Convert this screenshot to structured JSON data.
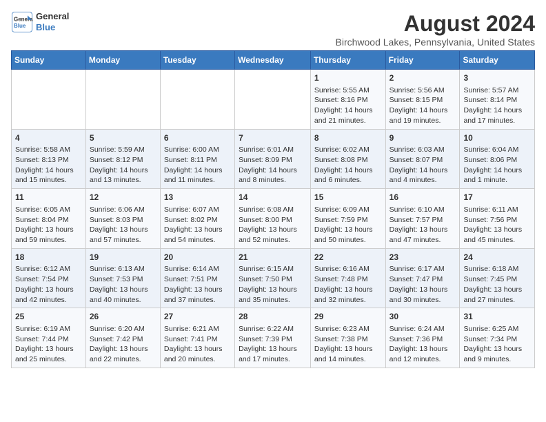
{
  "logo": {
    "line1": "General",
    "line2": "Blue"
  },
  "title": "August 2024",
  "subtitle": "Birchwood Lakes, Pennsylvania, United States",
  "days_of_week": [
    "Sunday",
    "Monday",
    "Tuesday",
    "Wednesday",
    "Thursday",
    "Friday",
    "Saturday"
  ],
  "weeks": [
    [
      {
        "day": "",
        "info": ""
      },
      {
        "day": "",
        "info": ""
      },
      {
        "day": "",
        "info": ""
      },
      {
        "day": "",
        "info": ""
      },
      {
        "day": "1",
        "info": "Sunrise: 5:55 AM\nSunset: 8:16 PM\nDaylight: 14 hours\nand 21 minutes."
      },
      {
        "day": "2",
        "info": "Sunrise: 5:56 AM\nSunset: 8:15 PM\nDaylight: 14 hours\nand 19 minutes."
      },
      {
        "day": "3",
        "info": "Sunrise: 5:57 AM\nSunset: 8:14 PM\nDaylight: 14 hours\nand 17 minutes."
      }
    ],
    [
      {
        "day": "4",
        "info": "Sunrise: 5:58 AM\nSunset: 8:13 PM\nDaylight: 14 hours\nand 15 minutes."
      },
      {
        "day": "5",
        "info": "Sunrise: 5:59 AM\nSunset: 8:12 PM\nDaylight: 14 hours\nand 13 minutes."
      },
      {
        "day": "6",
        "info": "Sunrise: 6:00 AM\nSunset: 8:11 PM\nDaylight: 14 hours\nand 11 minutes."
      },
      {
        "day": "7",
        "info": "Sunrise: 6:01 AM\nSunset: 8:09 PM\nDaylight: 14 hours\nand 8 minutes."
      },
      {
        "day": "8",
        "info": "Sunrise: 6:02 AM\nSunset: 8:08 PM\nDaylight: 14 hours\nand 6 minutes."
      },
      {
        "day": "9",
        "info": "Sunrise: 6:03 AM\nSunset: 8:07 PM\nDaylight: 14 hours\nand 4 minutes."
      },
      {
        "day": "10",
        "info": "Sunrise: 6:04 AM\nSunset: 8:06 PM\nDaylight: 14 hours\nand 1 minute."
      }
    ],
    [
      {
        "day": "11",
        "info": "Sunrise: 6:05 AM\nSunset: 8:04 PM\nDaylight: 13 hours\nand 59 minutes."
      },
      {
        "day": "12",
        "info": "Sunrise: 6:06 AM\nSunset: 8:03 PM\nDaylight: 13 hours\nand 57 minutes."
      },
      {
        "day": "13",
        "info": "Sunrise: 6:07 AM\nSunset: 8:02 PM\nDaylight: 13 hours\nand 54 minutes."
      },
      {
        "day": "14",
        "info": "Sunrise: 6:08 AM\nSunset: 8:00 PM\nDaylight: 13 hours\nand 52 minutes."
      },
      {
        "day": "15",
        "info": "Sunrise: 6:09 AM\nSunset: 7:59 PM\nDaylight: 13 hours\nand 50 minutes."
      },
      {
        "day": "16",
        "info": "Sunrise: 6:10 AM\nSunset: 7:57 PM\nDaylight: 13 hours\nand 47 minutes."
      },
      {
        "day": "17",
        "info": "Sunrise: 6:11 AM\nSunset: 7:56 PM\nDaylight: 13 hours\nand 45 minutes."
      }
    ],
    [
      {
        "day": "18",
        "info": "Sunrise: 6:12 AM\nSunset: 7:54 PM\nDaylight: 13 hours\nand 42 minutes."
      },
      {
        "day": "19",
        "info": "Sunrise: 6:13 AM\nSunset: 7:53 PM\nDaylight: 13 hours\nand 40 minutes."
      },
      {
        "day": "20",
        "info": "Sunrise: 6:14 AM\nSunset: 7:51 PM\nDaylight: 13 hours\nand 37 minutes."
      },
      {
        "day": "21",
        "info": "Sunrise: 6:15 AM\nSunset: 7:50 PM\nDaylight: 13 hours\nand 35 minutes."
      },
      {
        "day": "22",
        "info": "Sunrise: 6:16 AM\nSunset: 7:48 PM\nDaylight: 13 hours\nand 32 minutes."
      },
      {
        "day": "23",
        "info": "Sunrise: 6:17 AM\nSunset: 7:47 PM\nDaylight: 13 hours\nand 30 minutes."
      },
      {
        "day": "24",
        "info": "Sunrise: 6:18 AM\nSunset: 7:45 PM\nDaylight: 13 hours\nand 27 minutes."
      }
    ],
    [
      {
        "day": "25",
        "info": "Sunrise: 6:19 AM\nSunset: 7:44 PM\nDaylight: 13 hours\nand 25 minutes."
      },
      {
        "day": "26",
        "info": "Sunrise: 6:20 AM\nSunset: 7:42 PM\nDaylight: 13 hours\nand 22 minutes."
      },
      {
        "day": "27",
        "info": "Sunrise: 6:21 AM\nSunset: 7:41 PM\nDaylight: 13 hours\nand 20 minutes."
      },
      {
        "day": "28",
        "info": "Sunrise: 6:22 AM\nSunset: 7:39 PM\nDaylight: 13 hours\nand 17 minutes."
      },
      {
        "day": "29",
        "info": "Sunrise: 6:23 AM\nSunset: 7:38 PM\nDaylight: 13 hours\nand 14 minutes."
      },
      {
        "day": "30",
        "info": "Sunrise: 6:24 AM\nSunset: 7:36 PM\nDaylight: 13 hours\nand 12 minutes."
      },
      {
        "day": "31",
        "info": "Sunrise: 6:25 AM\nSunset: 7:34 PM\nDaylight: 13 hours\nand 9 minutes."
      }
    ]
  ]
}
